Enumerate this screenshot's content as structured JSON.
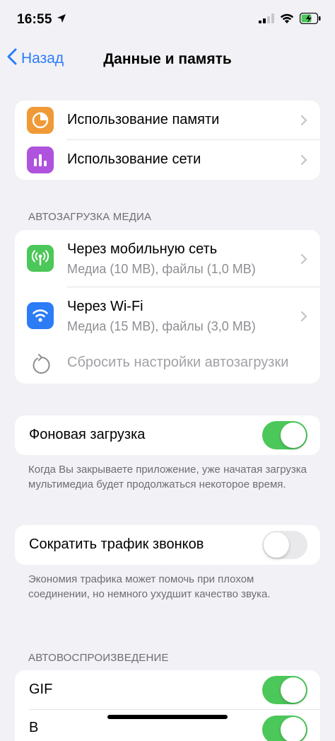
{
  "status_bar": {
    "time": "16:55"
  },
  "nav": {
    "back_label": "Назад",
    "title": "Данные и память"
  },
  "usage": {
    "items": [
      {
        "label": "Использование памяти",
        "icon": "storage-pie-icon",
        "color": "#F09A37"
      },
      {
        "label": "Использование сети",
        "icon": "network-bars-icon",
        "color": "#AF52DE"
      }
    ]
  },
  "media_autodownload": {
    "header": "АВТОЗАГРУЗКА МЕДИА",
    "items": [
      {
        "title": "Через мобильную сеть",
        "subtitle": "Медиа (10 MB), файлы (1,0 MB)",
        "icon": "cellular-antenna-icon",
        "color": "#4CC759"
      },
      {
        "title": "Через Wi-Fi",
        "subtitle": "Медиа (15 MB), файлы (3,0 MB)",
        "icon": "wifi-icon",
        "color": "#2C7CF6"
      }
    ],
    "reset_label": "Сбросить настройки автозагрузки"
  },
  "background_download": {
    "label": "Фоновая загрузка",
    "enabled": true,
    "footer": "Когда Вы закрываете приложение, уже начатая загрузка мультимедиа будет продолжаться некоторое время."
  },
  "call_traffic": {
    "label": "Сократить трафик звонков",
    "enabled": false,
    "footer": "Экономия трафика может помочь при плохом соединении, но немного ухудшит качество звука."
  },
  "autoplay": {
    "header": "АВТОВОСПРОИЗВЕДЕНИЕ",
    "items": [
      {
        "label": "GIF",
        "enabled": true
      },
      {
        "label": "В",
        "enabled": true
      }
    ]
  },
  "colors": {
    "accent": "#2C7CF6",
    "toggle_on": "#4CC759",
    "background": "#F1F1F6"
  }
}
